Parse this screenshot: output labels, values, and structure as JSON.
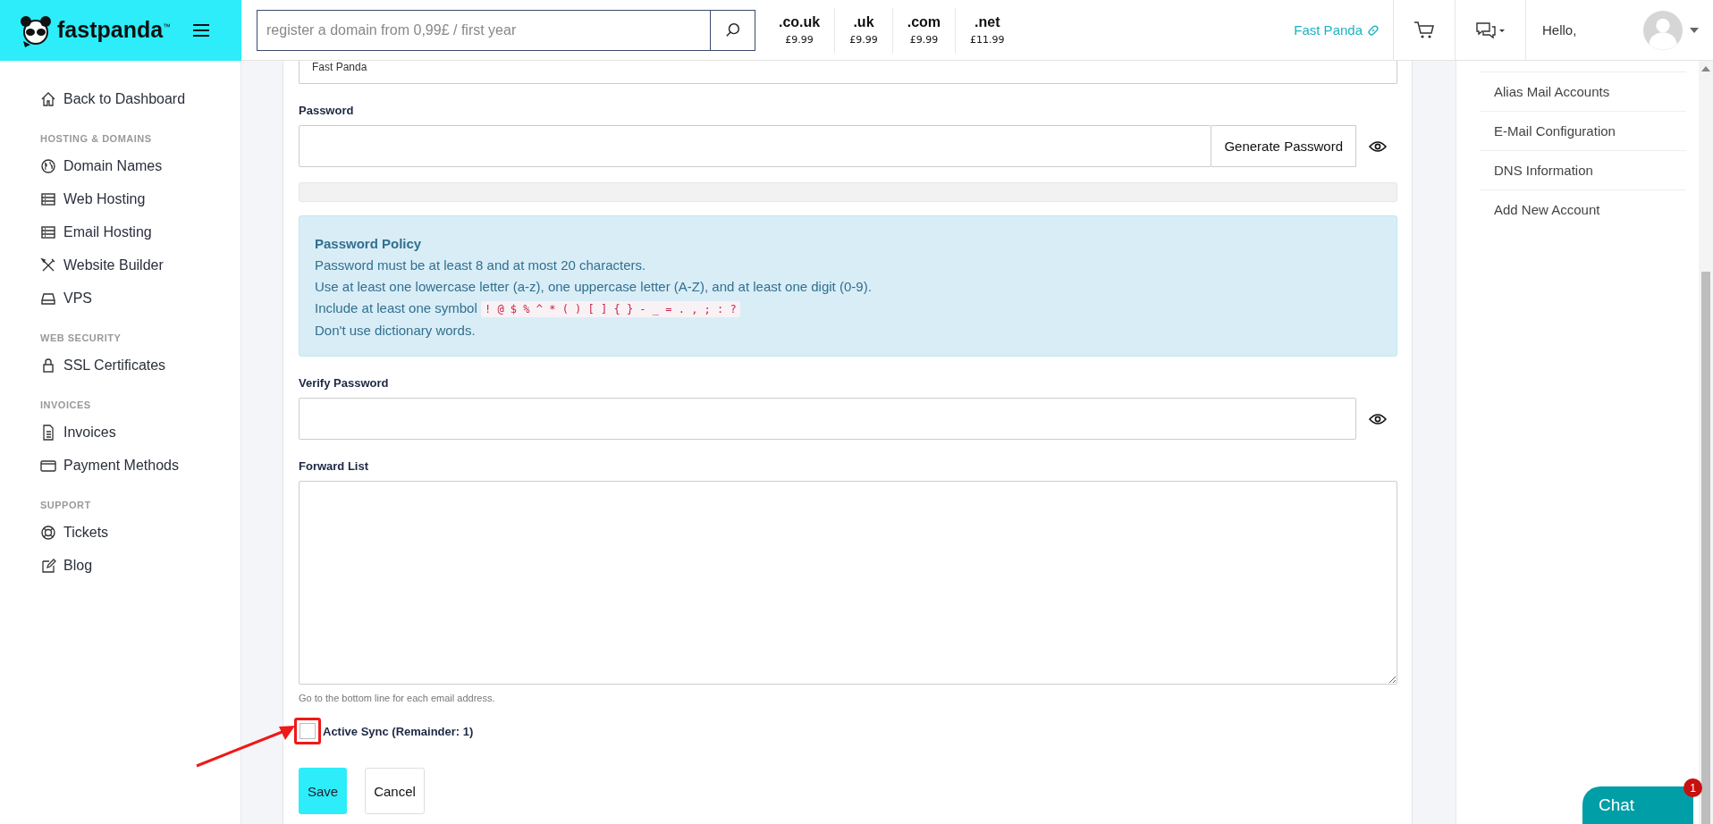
{
  "header": {
    "logo_text": "fastpanda",
    "logo_tm": "™",
    "search": {
      "placeholder": "register a domain from 0,99£ / first year"
    },
    "tlds": [
      {
        "name": ".co.uk",
        "price": "£9.99"
      },
      {
        "name": ".uk",
        "price": "£9.99"
      },
      {
        "name": ".com",
        "price": "£9.99"
      },
      {
        "name": ".net",
        "price": "£11.99"
      }
    ],
    "account_link": "Fast Panda",
    "greeting": "Hello,"
  },
  "sidebar": {
    "back": "Back to Dashboard",
    "sections": [
      {
        "heading": "HOSTING & DOMAINS",
        "items": [
          "Domain Names",
          "Web Hosting",
          "Email Hosting",
          "Website Builder",
          "VPS"
        ]
      },
      {
        "heading": "WEB SECURITY",
        "items": [
          "SSL Certificates"
        ]
      },
      {
        "heading": "INVOICES",
        "items": [
          "Invoices",
          "Payment Methods"
        ]
      },
      {
        "heading": "SUPPORT",
        "items": [
          "Tickets",
          "Blog"
        ]
      }
    ]
  },
  "form": {
    "name_value": "Fast Panda",
    "password": {
      "label": "Password",
      "generate": "Generate Password"
    },
    "policy": {
      "title": "Password Policy",
      "lines": [
        {
          "text": "Password must be at least 8 and at most 20 characters."
        },
        {
          "text": "Use at least one lowercase letter (a-z), one uppercase letter (A-Z), and at least one digit (0-9)."
        },
        {
          "text": "Include at least one symbol",
          "code": "! @ $ % ^ * ( ) [ ] { } - _ = . , ; : ?"
        },
        {
          "text": "Don't use dictionary words."
        }
      ]
    },
    "verify": {
      "label": "Verify Password"
    },
    "forward": {
      "label": "Forward List",
      "help": "Go to the bottom line for each email address."
    },
    "active_sync": {
      "label": "Active Sync (Remainder: 1)",
      "checked": false,
      "highlighted": true
    },
    "buttons": {
      "save": "Save",
      "cancel": "Cancel"
    }
  },
  "right_panel": {
    "items": [
      "Alias Mail Accounts",
      "E-Mail Configuration",
      "DNS Information",
      "Add New Account"
    ]
  },
  "chat": {
    "label": "Chat",
    "badge": "1"
  }
}
